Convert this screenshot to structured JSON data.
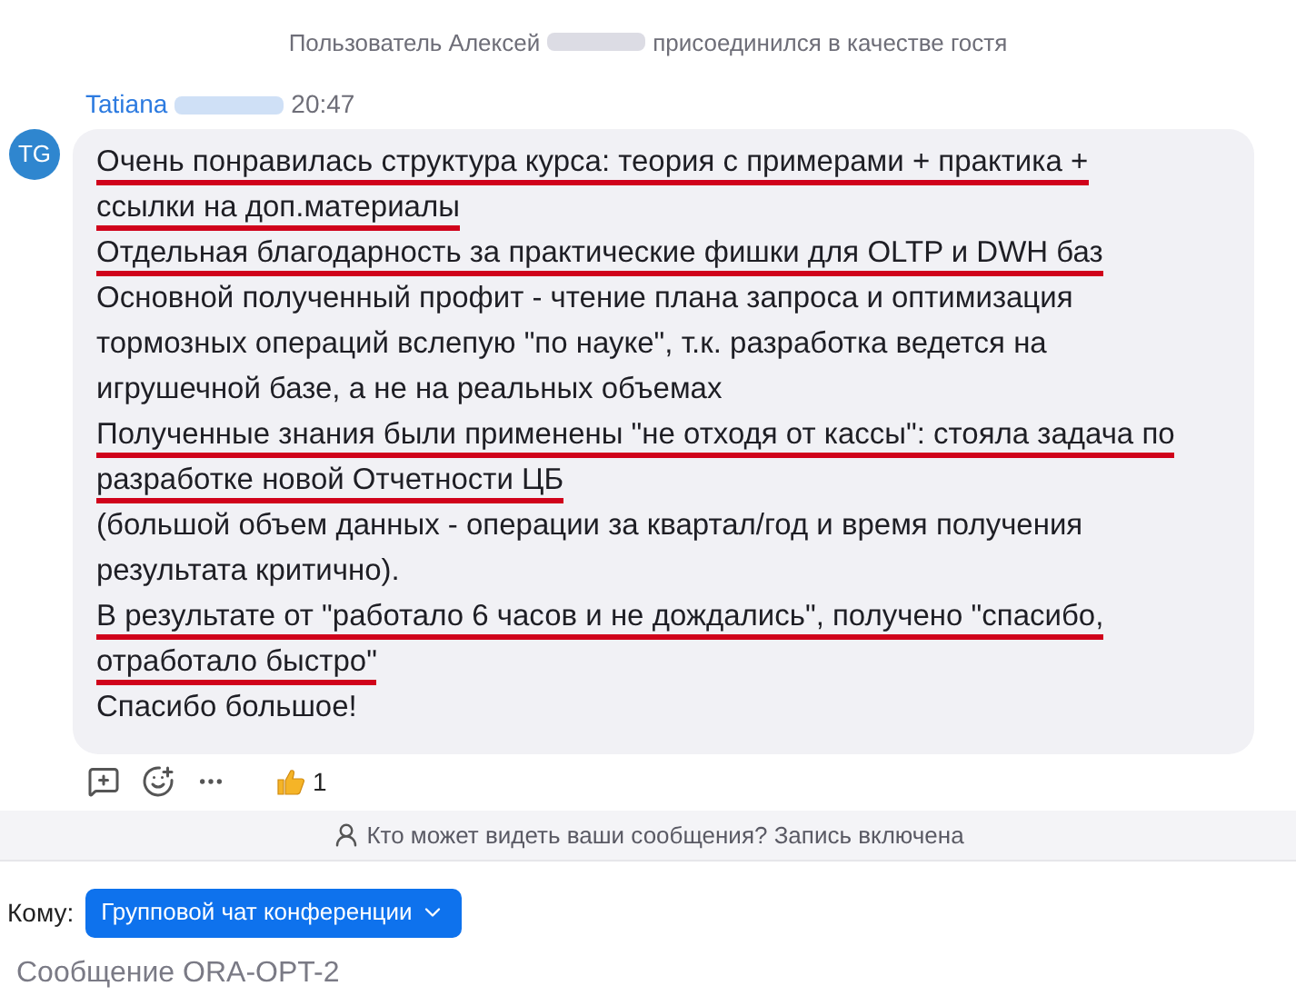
{
  "system_message": {
    "before": "Пользователь Алексей",
    "after": "присоединился в качестве гостя"
  },
  "message": {
    "avatar": "TG",
    "sender": "Tatiana",
    "time": "20:47",
    "lines": [
      {
        "text": "Очень понравилась структура курса: теория с примерами + практика +",
        "underlined": true
      },
      {
        "text": "ссылки на доп.материалы",
        "underlined": true
      },
      {
        "text": "Отдельная благодарность за практические фишки для OLTP и DWH баз",
        "underlined": true
      },
      {
        "text": "Основной полученный профит - чтение плана запроса и оптимизация",
        "underlined": false
      },
      {
        "text": "тормозных операций вслепую \"по науке\", т.к. разработка ведется на",
        "underlined": false
      },
      {
        "text": "игрушечной базе, а не на реальных объемах",
        "underlined": false
      },
      {
        "text": "Полученные знания были применены \"не отходя от кассы\": стояла задача по",
        "underlined": true
      },
      {
        "text": "разработке новой Отчетности ЦБ",
        "underlined": true
      },
      {
        "text": "(большой объем данных - операции за квартал/год и время получения",
        "underlined": false
      },
      {
        "text": "результата критично).",
        "underlined": false
      },
      {
        "text": "В результате от \"работало 6 часов и не дождались\", получено \"спасибо,",
        "underlined": true
      },
      {
        "text": "отработало быстро\"",
        "underlined": true
      },
      {
        "text": "Спасибо большое!",
        "underlined": false
      }
    ],
    "reactions": [
      {
        "count": "1"
      }
    ]
  },
  "notice": "Кто может видеть ваши сообщения? Запись включена",
  "composer": {
    "to_label": "Кому:",
    "recipient": "Групповой чат конференции",
    "placeholder": "Сообщение ORA-OPT-2"
  }
}
